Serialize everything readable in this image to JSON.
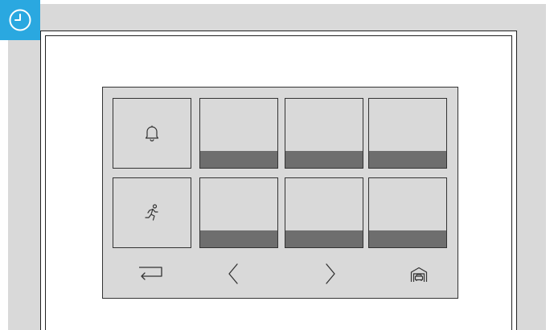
{
  "screen": {
    "top_row": [
      {
        "name": "alarm-bell-tile",
        "icon": "bell-icon",
        "has_bar": false
      },
      {
        "name": "tile-1-2",
        "icon": "",
        "has_bar": true
      },
      {
        "name": "tile-1-3",
        "icon": "",
        "has_bar": true
      },
      {
        "name": "tile-1-4",
        "icon": "",
        "has_bar": true
      }
    ],
    "bottom_row": [
      {
        "name": "emergency-exit-tile",
        "icon": "running-person-icon",
        "has_bar": false
      },
      {
        "name": "tile-2-2",
        "icon": "",
        "has_bar": true
      },
      {
        "name": "tile-2-3",
        "icon": "",
        "has_bar": true
      },
      {
        "name": "tile-2-4",
        "icon": "",
        "has_bar": true
      }
    ],
    "nav_icons": [
      "return-arrow-icon",
      "chevron-left-icon",
      "chevron-right-icon",
      "garage-car-icon"
    ]
  },
  "badge": {
    "icon": "clock-icon",
    "color": "#2aa8e0"
  },
  "colors": {
    "wall": "#d9d9d9",
    "tile_bar": "#6e6e6e",
    "outline": "#333333"
  }
}
